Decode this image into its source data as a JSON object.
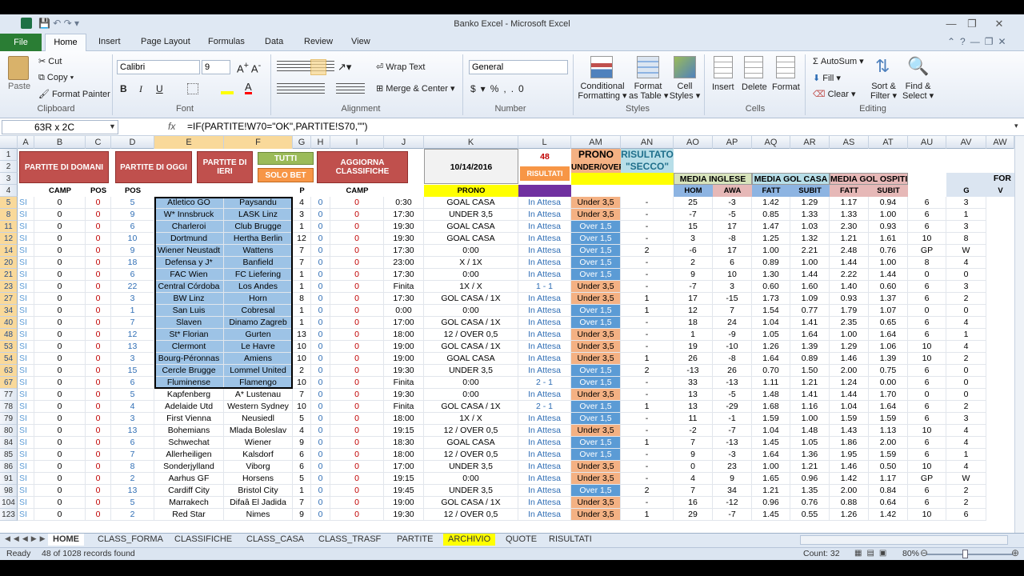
{
  "window": {
    "title": "Banko Excel - Microsoft Excel"
  },
  "ribbon_tabs": [
    "File",
    "Home",
    "Insert",
    "Page Layout",
    "Formulas",
    "Data",
    "Review",
    "View"
  ],
  "ribbon": {
    "clipboard": {
      "paste": "Paste",
      "cut": "Cut",
      "copy": "Copy",
      "format_painter": "Format Painter",
      "label": "Clipboard"
    },
    "font": {
      "name": "Calibri",
      "size": "9",
      "label": "Font"
    },
    "alignment": {
      "wrap": "Wrap Text",
      "merge": "Merge & Center",
      "label": "Alignment"
    },
    "number": {
      "format": "General",
      "label": "Number"
    },
    "styles": {
      "cond1": "Conditional",
      "cond2": "Formatting",
      "table1": "Format",
      "table2": "as Table",
      "cell1": "Cell",
      "cell2": "Styles",
      "label": "Styles"
    },
    "cells": {
      "insert": "Insert",
      "delete": "Delete",
      "format": "Format",
      "label": "Cells"
    },
    "editing": {
      "autosum": "AutoSum",
      "fill": "Fill",
      "clear": "Clear",
      "sort1": "Sort &",
      "sort2": "Filter",
      "find1": "Find &",
      "find2": "Select",
      "label": "Editing"
    }
  },
  "formula_bar": {
    "name_box": "63R x 2C",
    "fx": "fx",
    "formula": "=IF(PARTITE!W70=\"OK\",PARTITE!S70,\"\")"
  },
  "columns": [
    "A",
    "B",
    "C",
    "D",
    "E",
    "F",
    "G",
    "H",
    "I",
    "J",
    "K",
    "L",
    "AM",
    "AN",
    "AO",
    "AP",
    "AQ",
    "AR",
    "AS",
    "AT",
    "AU",
    "AV",
    "AW"
  ],
  "header": {
    "btn_domani": "PARTITE DI DOMANI",
    "btn_oggi": "PARTITE DI OGGI",
    "btn_ieri": "PARTITE DI IERI",
    "btn_tutti": "TUTTI",
    "btn_solo": "SOLO BET",
    "btn_aggiorna": "AGGIORNA CLASSIFICHE",
    "date": "10/14/2016",
    "count": "48",
    "risultati": "RISULTATI",
    "prono_top": "PRONO",
    "prono_sub": "UNDER/OVER",
    "risultato_top": "RISULTATO",
    "risultato_sub": "\"SECCO\"",
    "media_inglese": "MEDIA INGLESE",
    "media_casa": "MEDIA GOL CASA",
    "media_ospiti": "MEDIA GOL OSPITI",
    "for": "FOR",
    "r4": {
      "camp": "CAMP",
      "pos": "POS",
      "pos2": "POS",
      "p": "P",
      "camp2": "CAMP",
      "prono": "PRONO",
      "hom": "HOM",
      "awa": "AWA",
      "fatt": "FATT",
      "subit": "SUBIT",
      "fatt2": "FATT",
      "subit2": "SUBIT",
      "g": "G",
      "v": "V"
    }
  },
  "rows": [
    [
      "5",
      "SI",
      "0",
      "0",
      "5",
      "Atletico GO",
      "Paysandu",
      "4",
      "0",
      "0",
      "0:30",
      "GOAL CASA",
      "In Attesa",
      "Under 3,5",
      "-",
      "25",
      "-3",
      "1.42",
      "1.29",
      "1.17",
      "0.94",
      "6",
      "3"
    ],
    [
      "8",
      "SI",
      "0",
      "0",
      "9",
      "W* Innsbruck",
      "LASK Linz",
      "3",
      "0",
      "0",
      "17:30",
      "UNDER 3,5",
      "In Attesa",
      "Under 3,5",
      "-",
      "-7",
      "-5",
      "0.85",
      "1.33",
      "1.33",
      "1.00",
      "6",
      "1"
    ],
    [
      "11",
      "SI",
      "0",
      "0",
      "6",
      "Charleroi",
      "Club Brugge",
      "1",
      "0",
      "0",
      "19:30",
      "GOAL CASA",
      "In Attesa",
      "Over 1,5",
      "-",
      "15",
      "17",
      "1.47",
      "1.03",
      "2.30",
      "0.93",
      "6",
      "3"
    ],
    [
      "12",
      "SI",
      "0",
      "0",
      "10",
      "Dortmund",
      "Hertha Berlin",
      "12",
      "0",
      "0",
      "19:30",
      "GOAL CASA",
      "In Attesa",
      "Over 1,5",
      "-",
      "3",
      "-8",
      "1.25",
      "1.32",
      "1.21",
      "1.61",
      "10",
      "8"
    ],
    [
      "14",
      "SI",
      "0",
      "0",
      "9",
      "Wiener Neustadt",
      "Wattens",
      "7",
      "0",
      "0",
      "17:30",
      "0:00",
      "In Attesa",
      "Over 1,5",
      "2",
      "-6",
      "17",
      "1.00",
      "2.21",
      "2.48",
      "0.76",
      "GP",
      "W"
    ],
    [
      "20",
      "SI",
      "0",
      "0",
      "18",
      "Defensa y J*",
      "Banfield",
      "7",
      "0",
      "0",
      "23:00",
      "X / 1X",
      "In Attesa",
      "Over 1,5",
      "-",
      "2",
      "6",
      "0.89",
      "1.00",
      "1.44",
      "1.00",
      "8",
      "4"
    ],
    [
      "21",
      "SI",
      "0",
      "0",
      "6",
      "FAC Wien",
      "FC Liefering",
      "1",
      "0",
      "0",
      "17:30",
      "0:00",
      "In Attesa",
      "Over 1,5",
      "-",
      "9",
      "10",
      "1.30",
      "1.44",
      "2.22",
      "1.44",
      "0",
      "0"
    ],
    [
      "23",
      "SI",
      "0",
      "0",
      "22",
      "Central Córdoba",
      "Los Andes",
      "1",
      "0",
      "0",
      "Finita",
      "1X / X",
      "1 - 1",
      "Under 3,5",
      "-",
      "-7",
      "3",
      "0.60",
      "1.60",
      "1.40",
      "0.60",
      "6",
      "3"
    ],
    [
      "27",
      "SI",
      "0",
      "0",
      "3",
      "BW Linz",
      "Horn",
      "8",
      "0",
      "0",
      "17:30",
      "GOL CASA / 1X",
      "In Attesa",
      "Under 3,5",
      "1",
      "17",
      "-15",
      "1.73",
      "1.09",
      "0.93",
      "1.37",
      "6",
      "2"
    ],
    [
      "34",
      "SI",
      "0",
      "0",
      "1",
      "San Luis",
      "Cobresal",
      "1",
      "0",
      "0",
      "0:00",
      "0:00",
      "In Attesa",
      "Over 1,5",
      "1",
      "12",
      "7",
      "1.54",
      "0.77",
      "1.79",
      "1.07",
      "0",
      "0"
    ],
    [
      "40",
      "SI",
      "0",
      "0",
      "7",
      "Slaven",
      "Dinamo Zagreb",
      "1",
      "0",
      "0",
      "17:00",
      "GOL CASA / 1X",
      "In Attesa",
      "Over 1,5",
      "-",
      "18",
      "24",
      "1.04",
      "1.41",
      "2.35",
      "0.65",
      "6",
      "4"
    ],
    [
      "48",
      "SI",
      "0",
      "0",
      "12",
      "St* Florian",
      "Gurten",
      "13",
      "0",
      "0",
      "18:00",
      "12 / OVER 0,5",
      "In Attesa",
      "Under 3,5",
      "-",
      "1",
      "-9",
      "1.05",
      "1.64",
      "1.00",
      "1.64",
      "6",
      "1"
    ],
    [
      "53",
      "SI",
      "0",
      "0",
      "13",
      "Clermont",
      "Le Havre",
      "10",
      "0",
      "0",
      "19:00",
      "GOL CASA / 1X",
      "In Attesa",
      "Under 3,5",
      "-",
      "19",
      "-10",
      "1.26",
      "1.39",
      "1.29",
      "1.06",
      "10",
      "4"
    ],
    [
      "54",
      "SI",
      "0",
      "0",
      "3",
      "Bourg-Péronnas",
      "Amiens",
      "10",
      "0",
      "0",
      "19:00",
      "GOAL CASA",
      "In Attesa",
      "Under 3,5",
      "1",
      "26",
      "-8",
      "1.64",
      "0.89",
      "1.46",
      "1.39",
      "10",
      "2"
    ],
    [
      "63",
      "SI",
      "0",
      "0",
      "15",
      "Cercle Brugge",
      "Lommel United",
      "2",
      "0",
      "0",
      "19:30",
      "UNDER 3,5",
      "In Attesa",
      "Over 1,5",
      "2",
      "-13",
      "26",
      "0.70",
      "1.50",
      "2.00",
      "0.75",
      "6",
      "0"
    ],
    [
      "67",
      "SI",
      "0",
      "0",
      "6",
      "Fluminense",
      "Flamengo",
      "10",
      "0",
      "0",
      "Finita",
      "0:00",
      "2 - 1",
      "Over 1,5",
      "-",
      "33",
      "-13",
      "1.11",
      "1.21",
      "1.24",
      "0.00",
      "6",
      "0"
    ],
    [
      "77",
      "SI",
      "0",
      "0",
      "5",
      "Kapfenberg",
      "A* Lustenau",
      "7",
      "0",
      "0",
      "19:30",
      "0:00",
      "In Attesa",
      "Under 3,5",
      "-",
      "13",
      "-5",
      "1.48",
      "1.41",
      "1.44",
      "1.70",
      "0",
      "0"
    ],
    [
      "78",
      "SI",
      "0",
      "0",
      "4",
      "Adelaide Utd",
      "Western Sydney",
      "10",
      "0",
      "0",
      "Finita",
      "GOL CASA / 1X",
      "2 - 1",
      "Over 1,5",
      "1",
      "13",
      "-29",
      "1.68",
      "1.16",
      "1.04",
      "1.64",
      "6",
      "2"
    ],
    [
      "79",
      "SI",
      "0",
      "0",
      "3",
      "First Vienna",
      "Neusiedl",
      "5",
      "0",
      "0",
      "18:00",
      "1X / X",
      "In Attesa",
      "Over 1,5",
      "-",
      "11",
      "-1",
      "1.59",
      "1.00",
      "1.59",
      "1.59",
      "6",
      "3"
    ],
    [
      "80",
      "SI",
      "0",
      "0",
      "13",
      "Bohemians",
      "Mlada Boleslav",
      "4",
      "0",
      "0",
      "19:15",
      "12 / OVER 0,5",
      "In Attesa",
      "Under 3,5",
      "-",
      "-2",
      "-7",
      "1.04",
      "1.48",
      "1.43",
      "1.13",
      "10",
      "4"
    ],
    [
      "84",
      "SI",
      "0",
      "0",
      "6",
      "Schwechat",
      "Wiener",
      "9",
      "0",
      "0",
      "18:30",
      "GOAL CASA",
      "In Attesa",
      "Over 1,5",
      "1",
      "7",
      "-13",
      "1.45",
      "1.05",
      "1.86",
      "2.00",
      "6",
      "4"
    ],
    [
      "85",
      "SI",
      "0",
      "0",
      "7",
      "Allerheiligen",
      "Kalsdorf",
      "6",
      "0",
      "0",
      "18:00",
      "12 / OVER 0,5",
      "In Attesa",
      "Over 1,5",
      "-",
      "9",
      "-3",
      "1.64",
      "1.36",
      "1.95",
      "1.59",
      "6",
      "1"
    ],
    [
      "86",
      "SI",
      "0",
      "0",
      "8",
      "Sonderjylland",
      "Viborg",
      "6",
      "0",
      "0",
      "17:00",
      "UNDER 3,5",
      "In Attesa",
      "Under 3,5",
      "-",
      "0",
      "23",
      "1.00",
      "1.21",
      "1.46",
      "0.50",
      "10",
      "4"
    ],
    [
      "91",
      "SI",
      "0",
      "0",
      "2",
      "Aarhus GF",
      "Horsens",
      "5",
      "0",
      "0",
      "19:15",
      "0:00",
      "In Attesa",
      "Under 3,5",
      "-",
      "4",
      "9",
      "1.65",
      "0.96",
      "1.42",
      "1.17",
      "GP",
      "W"
    ],
    [
      "98",
      "SI",
      "0",
      "0",
      "13",
      "Cardiff City",
      "Bristol City",
      "1",
      "0",
      "0",
      "19:45",
      "UNDER 3,5",
      "In Attesa",
      "Over 1,5",
      "2",
      "7",
      "34",
      "1.21",
      "1.35",
      "2.00",
      "0.84",
      "6",
      "2"
    ],
    [
      "104",
      "SI",
      "0",
      "0",
      "5",
      "Marrakech",
      "Difaâ El Jadida",
      "7",
      "0",
      "0",
      "19:00",
      "GOL CASA / 1X",
      "In Attesa",
      "Under 3,5",
      "-",
      "16",
      "-12",
      "0.96",
      "0.76",
      "0.88",
      "0.64",
      "6",
      "2"
    ],
    [
      "123",
      "SI",
      "0",
      "0",
      "2",
      "Red Star",
      "Nimes",
      "9",
      "0",
      "0",
      "19:30",
      "12 / OVER 0,5",
      "In Attesa",
      "Under 3,5",
      "1",
      "29",
      "-7",
      "1.45",
      "0.55",
      "1.26",
      "1.42",
      "10",
      "6"
    ]
  ],
  "sheet_tabs": [
    "HOME",
    "CLASS_FORMA",
    "CLASSIFICHE",
    "CLASS_CASA",
    "CLASS_TRASF",
    "PARTITE",
    "ARCHIVIO",
    "QUOTE",
    "RISULTATI"
  ],
  "status": {
    "ready": "Ready",
    "records": "48 of 1028 records found",
    "count": "Count: 32",
    "zoom": "80%"
  },
  "colors": {
    "accent_green": "#2a7d34",
    "red_button": "#c0504d",
    "selection_blue": "#9dc3e6",
    "prono_yellow": "#ffff00",
    "under_orange": "#f4b183",
    "over_blue": "#5b9bd5",
    "header_green": "#d8e4bc"
  }
}
